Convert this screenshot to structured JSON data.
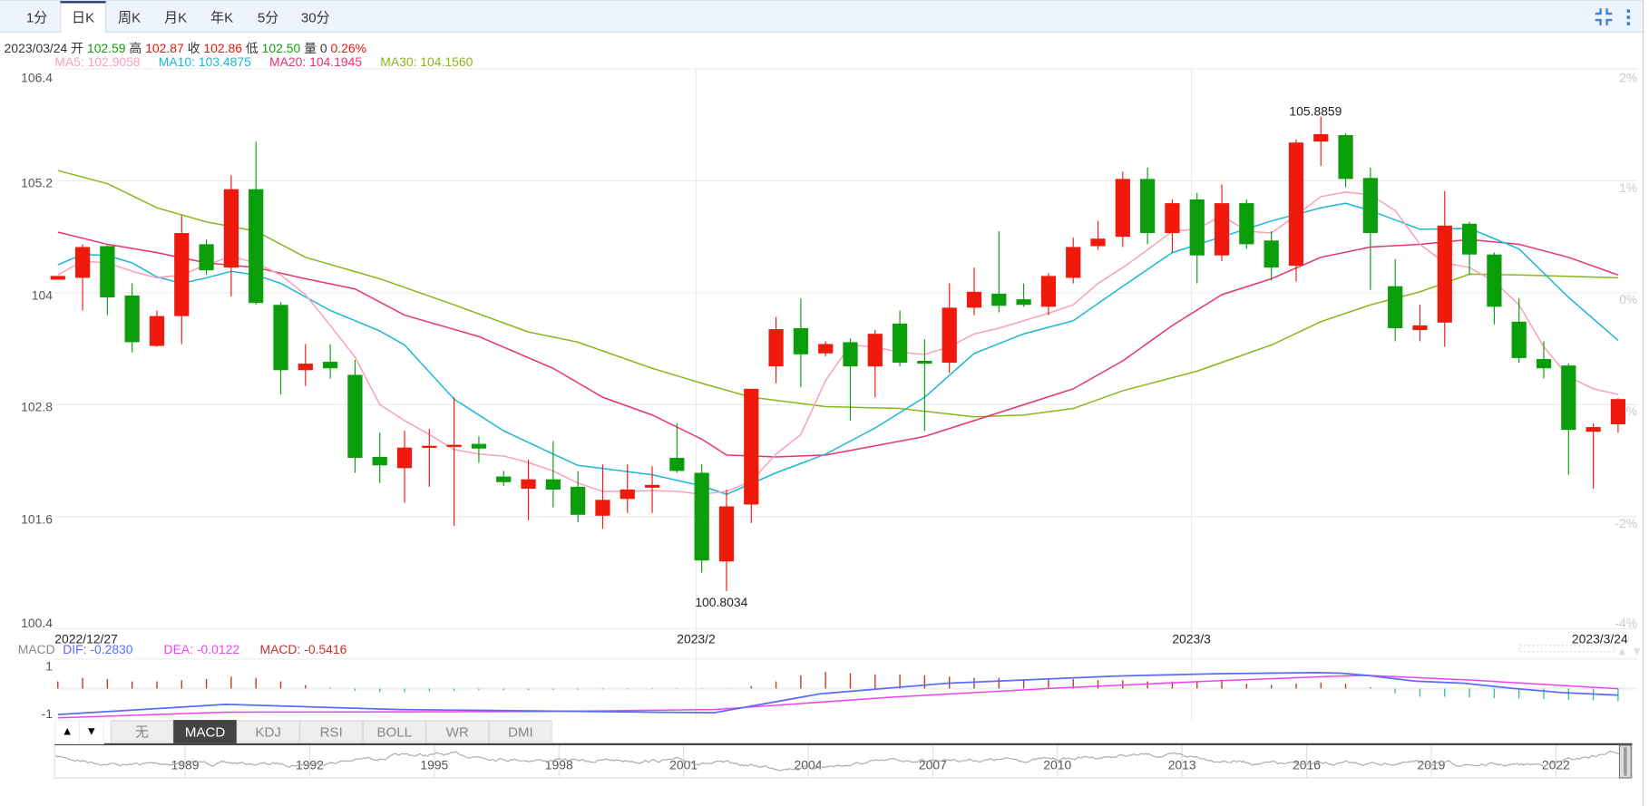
{
  "tabs": [
    {
      "label": "1分"
    },
    {
      "label": "日K",
      "active": true
    },
    {
      "label": "周K"
    },
    {
      "label": "月K"
    },
    {
      "label": "年K"
    },
    {
      "label": "5分"
    },
    {
      "label": "30分"
    }
  ],
  "toolbar_icons": [
    "compress-icon",
    "more-vertical-icon"
  ],
  "header": {
    "date": "2023/03/24",
    "open_label": "开",
    "open": "102.59",
    "high_label": "高",
    "high": "102.87",
    "close_label": "收",
    "close": "102.86",
    "low_label": "低",
    "low": "102.50",
    "vol_label": "量",
    "vol": "0",
    "change": "0.26%"
  },
  "ma_legend": {
    "ma5": "MA5: 102.9058",
    "ma10": "MA10: 103.4875",
    "ma20": "MA20: 104.1945",
    "ma30": "MA30: 104.1560"
  },
  "macd_legend": {
    "title": "MACD",
    "dif": "DIF: -0.2830",
    "dea": "DEA: -0.0122",
    "macd": "MACD: -0.5416"
  },
  "colors": {
    "up": "#f01a0c",
    "down": "#0a9e0a",
    "ma5": "#f7a1ba",
    "ma10": "#1ab7d6",
    "ma20": "#e8336d",
    "ma30": "#8cb51a",
    "dif": "#5a6bff",
    "dea": "#ee44ee",
    "macd_pos": "#c0392b",
    "macd_neg": "#3cc49a",
    "accent": "#3b7dd8"
  },
  "chart_data": {
    "type": "candlestick",
    "price_ticks": [
      "106.4",
      "105.2",
      "104",
      "102.8",
      "101.6",
      "100.4"
    ],
    "price_tick_values": [
      106.4,
      105.2,
      104.0,
      102.8,
      101.6,
      100.4
    ],
    "pct_ticks": [
      "2%",
      "1%",
      "0%",
      "-1%",
      "-2%",
      "-4%"
    ],
    "ylim": [
      100.4,
      106.4
    ],
    "x_labels": [
      {
        "text": "2022/12/27",
        "index": 0
      },
      {
        "text": "2023/2",
        "index": 25.8
      },
      {
        "text": "2023/3",
        "index": 45.8
      },
      {
        "text": "2023/3/24",
        "index": 63
      }
    ],
    "annotations": [
      {
        "text": "105.8859",
        "index": 51,
        "value": 105.8859
      },
      {
        "text": "100.8034",
        "index": 27,
        "value": 100.8034
      }
    ],
    "candles_ohlc": [
      [
        104.14,
        104.18,
        104.14,
        104.18
      ],
      [
        104.16,
        104.52,
        103.81,
        104.49
      ],
      [
        104.5,
        104.51,
        103.76,
        103.95
      ],
      [
        103.97,
        104.1,
        103.36,
        103.47
      ],
      [
        103.43,
        103.81,
        103.42,
        103.75
      ],
      [
        103.75,
        104.83,
        103.45,
        104.64
      ],
      [
        104.52,
        104.57,
        104.19,
        104.24
      ],
      [
        104.27,
        105.26,
        103.96,
        105.11
      ],
      [
        105.11,
        105.62,
        103.87,
        103.89
      ],
      [
        103.87,
        103.9,
        102.91,
        103.17
      ],
      [
        103.17,
        103.45,
        103.0,
        103.24
      ],
      [
        103.26,
        103.45,
        103.08,
        103.19
      ],
      [
        103.12,
        103.28,
        102.07,
        102.23
      ],
      [
        102.24,
        102.5,
        101.96,
        102.15
      ],
      [
        102.12,
        102.52,
        101.75,
        102.34
      ],
      [
        102.34,
        102.54,
        101.92,
        102.36
      ],
      [
        102.35,
        102.88,
        101.5,
        102.37
      ],
      [
        102.38,
        102.46,
        102.18,
        102.33
      ],
      [
        102.03,
        102.09,
        101.93,
        101.97
      ],
      [
        101.9,
        102.21,
        101.56,
        102.0
      ],
      [
        102.0,
        102.41,
        101.7,
        101.89
      ],
      [
        101.92,
        102.09,
        101.54,
        101.62
      ],
      [
        101.61,
        102.16,
        101.47,
        101.78
      ],
      [
        101.79,
        102.16,
        101.64,
        101.89
      ],
      [
        101.91,
        102.14,
        101.64,
        101.94
      ],
      [
        102.23,
        102.6,
        102.07,
        102.09
      ],
      [
        102.07,
        102.16,
        101.0,
        101.13
      ],
      [
        101.12,
        101.89,
        100.8034,
        101.71
      ],
      [
        101.73,
        102.97,
        101.53,
        102.97
      ],
      [
        103.21,
        103.74,
        103.03,
        103.61
      ],
      [
        103.62,
        103.94,
        102.99,
        103.34
      ],
      [
        103.35,
        103.48,
        103.32,
        103.45
      ],
      [
        103.47,
        103.51,
        102.63,
        103.21
      ],
      [
        103.21,
        103.6,
        102.88,
        103.56
      ],
      [
        103.67,
        103.81,
        103.21,
        103.25
      ],
      [
        103.27,
        103.5,
        102.52,
        103.24
      ],
      [
        103.25,
        104.1,
        103.14,
        103.84
      ],
      [
        103.84,
        104.27,
        103.76,
        104.01
      ],
      [
        103.99,
        104.66,
        103.79,
        103.86
      ],
      [
        103.93,
        104.1,
        103.85,
        103.87
      ],
      [
        103.85,
        104.21,
        103.76,
        104.18
      ],
      [
        104.16,
        104.59,
        104.1,
        104.49
      ],
      [
        104.5,
        104.77,
        104.46,
        104.58
      ],
      [
        104.6,
        105.3,
        104.49,
        105.22
      ],
      [
        105.22,
        105.34,
        104.52,
        104.64
      ],
      [
        104.64,
        105.0,
        104.43,
        104.96
      ],
      [
        105.0,
        105.07,
        104.1,
        104.4
      ],
      [
        104.4,
        105.16,
        104.34,
        104.96
      ],
      [
        104.96,
        105.0,
        104.47,
        104.52
      ],
      [
        104.56,
        104.66,
        104.13,
        104.27
      ],
      [
        104.29,
        105.64,
        104.12,
        105.61
      ],
      [
        105.62,
        105.8859,
        105.36,
        105.7
      ],
      [
        105.69,
        105.71,
        105.13,
        105.22
      ],
      [
        105.23,
        105.34,
        104.03,
        104.64
      ],
      [
        104.07,
        104.36,
        103.48,
        103.62
      ],
      [
        103.6,
        103.87,
        103.48,
        103.65
      ],
      [
        103.68,
        105.09,
        103.42,
        104.72
      ],
      [
        104.74,
        104.76,
        104.19,
        104.41
      ],
      [
        104.41,
        104.43,
        103.66,
        103.85
      ],
      [
        103.69,
        103.94,
        103.25,
        103.3
      ],
      [
        103.29,
        103.48,
        103.08,
        103.19
      ],
      [
        103.22,
        103.24,
        102.05,
        102.53
      ],
      [
        102.51,
        102.6,
        101.9,
        102.56
      ],
      [
        102.59,
        102.87,
        102.5,
        102.86
      ]
    ],
    "ma5": [
      104.19,
      104.34,
      104.32,
      104.23,
      104.16,
      104.19,
      104.3,
      104.39,
      104.32,
      104.19,
      103.98,
      103.65,
      103.31,
      102.8,
      102.63,
      102.48,
      102.32,
      102.27,
      102.25,
      102.18,
      102.09,
      101.96,
      101.87,
      101.87,
      101.88,
      101.87,
      101.84,
      101.87,
      101.98,
      102.27,
      102.48,
      103.06,
      103.44,
      103.42,
      103.36,
      103.34,
      103.42,
      103.56,
      103.62,
      103.7,
      103.78,
      103.87,
      104.1,
      104.27,
      104.46,
      104.66,
      104.68,
      104.83,
      104.66,
      104.64,
      104.83,
      105.03,
      105.08,
      105.05,
      104.88,
      104.52,
      104.32,
      104.27,
      104.12,
      103.87,
      103.42,
      103.1,
      102.97,
      102.91
    ],
    "ma10": [
      [
        0,
        104.3
      ],
      [
        1,
        104.41
      ],
      [
        2,
        104.4
      ],
      [
        3,
        104.32
      ],
      [
        4,
        104.17
      ],
      [
        5,
        104.1
      ],
      [
        6,
        104.16
      ],
      [
        7,
        104.23
      ],
      [
        8,
        104.19
      ],
      [
        9,
        104.1
      ],
      [
        11,
        103.81
      ],
      [
        13,
        103.59
      ],
      [
        14,
        103.44
      ],
      [
        16,
        102.86
      ],
      [
        18,
        102.52
      ],
      [
        20,
        102.27
      ],
      [
        21,
        102.15
      ],
      [
        24,
        102.05
      ],
      [
        26,
        101.93
      ],
      [
        27,
        101.84
      ],
      [
        29,
        102.07
      ],
      [
        31,
        102.27
      ],
      [
        33,
        102.55
      ],
      [
        35,
        102.88
      ],
      [
        37,
        103.35
      ],
      [
        39,
        103.56
      ],
      [
        41,
        103.7
      ],
      [
        43,
        104.07
      ],
      [
        45,
        104.43
      ],
      [
        47,
        104.6
      ],
      [
        49,
        104.77
      ],
      [
        51,
        104.91
      ],
      [
        52,
        104.96
      ],
      [
        53,
        104.88
      ],
      [
        55,
        104.68
      ],
      [
        57,
        104.69
      ],
      [
        59,
        104.47
      ],
      [
        61,
        103.95
      ],
      [
        63,
        103.49
      ]
    ],
    "ma20": [
      [
        0,
        104.65
      ],
      [
        2,
        104.52
      ],
      [
        4,
        104.43
      ],
      [
        6,
        104.32
      ],
      [
        8,
        104.27
      ],
      [
        10,
        104.15
      ],
      [
        12,
        104.04
      ],
      [
        14,
        103.76
      ],
      [
        17,
        103.53
      ],
      [
        20,
        103.19
      ],
      [
        22,
        102.88
      ],
      [
        24,
        102.69
      ],
      [
        26,
        102.43
      ],
      [
        27,
        102.26
      ],
      [
        29,
        102.24
      ],
      [
        31,
        102.26
      ],
      [
        33,
        102.36
      ],
      [
        35,
        102.46
      ],
      [
        37,
        102.63
      ],
      [
        39,
        102.8
      ],
      [
        41,
        102.97
      ],
      [
        43,
        103.27
      ],
      [
        45,
        103.65
      ],
      [
        47,
        103.98
      ],
      [
        49,
        104.15
      ],
      [
        51,
        104.38
      ],
      [
        53,
        104.49
      ],
      [
        55,
        104.52
      ],
      [
        57,
        104.57
      ],
      [
        59,
        104.52
      ],
      [
        61,
        104.38
      ],
      [
        63,
        104.19
      ]
    ],
    "ma30": [
      [
        0,
        105.31
      ],
      [
        2,
        105.17
      ],
      [
        4,
        104.91
      ],
      [
        6,
        104.76
      ],
      [
        8,
        104.66
      ],
      [
        10,
        104.38
      ],
      [
        13,
        104.15
      ],
      [
        16,
        103.87
      ],
      [
        19,
        103.58
      ],
      [
        21,
        103.47
      ],
      [
        24,
        103.19
      ],
      [
        26,
        103.03
      ],
      [
        28,
        102.88
      ],
      [
        31,
        102.78
      ],
      [
        34,
        102.76
      ],
      [
        37,
        102.67
      ],
      [
        39,
        102.69
      ],
      [
        41,
        102.76
      ],
      [
        43,
        102.95
      ],
      [
        46,
        103.16
      ],
      [
        49,
        103.44
      ],
      [
        51,
        103.69
      ],
      [
        53,
        103.87
      ],
      [
        55,
        104.01
      ],
      [
        57,
        104.2
      ],
      [
        59,
        104.19
      ],
      [
        63,
        104.16
      ]
    ],
    "macd": {
      "ticks": [
        "1",
        "-1"
      ],
      "histogram": [
        0.3,
        0.45,
        0.4,
        0.3,
        0.3,
        0.35,
        0.4,
        0.5,
        0.45,
        0.3,
        0.15,
        0.03,
        -0.1,
        -0.15,
        -0.15,
        -0.12,
        -0.1,
        -0.08,
        -0.08,
        -0.07,
        -0.06,
        -0.05,
        -0.04,
        -0.03,
        -0.03,
        -0.02,
        -0.02,
        -0.01,
        0.1,
        0.3,
        0.55,
        0.7,
        0.65,
        0.6,
        0.6,
        0.55,
        0.5,
        0.45,
        0.45,
        0.4,
        0.45,
        0.4,
        0.35,
        0.35,
        0.3,
        0.3,
        0.28,
        0.3,
        0.2,
        0.15,
        0.2,
        0.25,
        0.2,
        0.05,
        -0.2,
        -0.35,
        -0.35,
        -0.38,
        -0.4,
        -0.42,
        -0.45,
        -0.48,
        -0.5,
        -0.54
      ],
      "dif": [
        [
          0,
          -1.1
        ],
        [
          6.8,
          -0.67
        ],
        [
          13.8,
          -0.89
        ],
        [
          24,
          -1.0
        ],
        [
          26.5,
          -1.02
        ],
        [
          30.8,
          -0.22
        ],
        [
          35.9,
          0.22
        ],
        [
          42.8,
          0.53
        ],
        [
          46.8,
          0.62
        ],
        [
          50.8,
          0.67
        ],
        [
          51.8,
          0.65
        ],
        [
          52.9,
          0.55
        ],
        [
          54.8,
          0.31
        ],
        [
          56.8,
          0.22
        ],
        [
          58.8,
          0.0
        ],
        [
          60.8,
          -0.18
        ],
        [
          63,
          -0.28
        ]
      ],
      "dea": [
        [
          0,
          -1.24
        ],
        [
          6.8,
          -1.0
        ],
        [
          19,
          -0.98
        ],
        [
          26.5,
          -0.89
        ],
        [
          33.8,
          -0.36
        ],
        [
          40,
          0.0
        ],
        [
          46.5,
          0.31
        ],
        [
          51.8,
          0.53
        ],
        [
          52.9,
          0.55
        ],
        [
          57,
          0.36
        ],
        [
          63,
          -0.01
        ]
      ]
    }
  },
  "indicator_tabs": [
    {
      "label": "无"
    },
    {
      "label": "MACD",
      "active": true
    },
    {
      "label": "KDJ"
    },
    {
      "label": "RSI"
    },
    {
      "label": "BOLL"
    },
    {
      "label": "WR"
    },
    {
      "label": "DMI"
    }
  ],
  "scroll_buttons": {
    "up": "▲",
    "down": "▼"
  },
  "navigator": {
    "years": [
      "1989",
      "1992",
      "1995",
      "1998",
      "2001",
      "2004",
      "2007",
      "2010",
      "2013",
      "2016",
      "2019",
      "2022"
    ]
  }
}
